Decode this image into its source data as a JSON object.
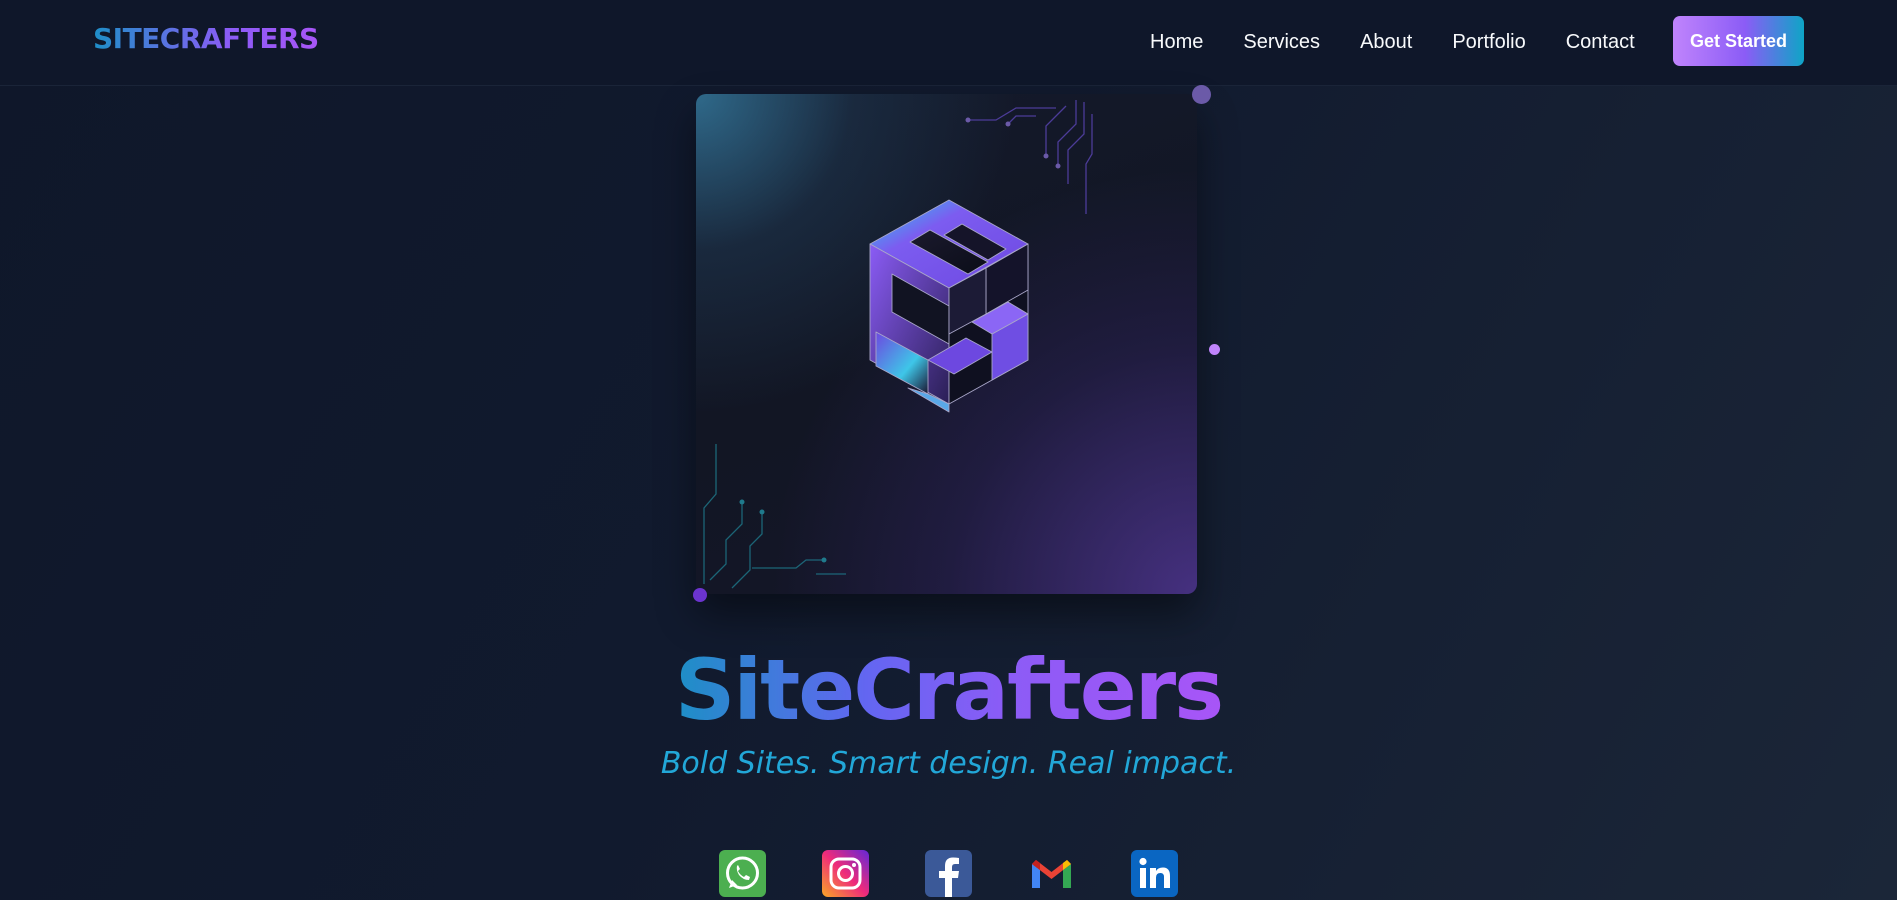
{
  "nav": {
    "brand": "SITECRAFTERS",
    "links": [
      {
        "label": "Home"
      },
      {
        "label": "Services"
      },
      {
        "label": "About"
      },
      {
        "label": "Portfolio"
      },
      {
        "label": "Contact"
      }
    ],
    "cta_label": "Get Started"
  },
  "hero": {
    "title": "SiteCrafters",
    "tagline": "Bold Sites. Smart design. Real impact."
  },
  "social": [
    {
      "name": "whatsapp-icon",
      "color": "#4caf50"
    },
    {
      "name": "instagram-icon",
      "color": "#d6249f"
    },
    {
      "name": "facebook-icon",
      "color": "#3b5998"
    },
    {
      "name": "gmail-icon",
      "color": "#ea4335"
    },
    {
      "name": "linkedin-icon",
      "color": "#0a66c2"
    }
  ],
  "colors": {
    "background": "#0f172a",
    "accent_purple": "#8b5cf6",
    "accent_cyan": "#22a7d8"
  }
}
